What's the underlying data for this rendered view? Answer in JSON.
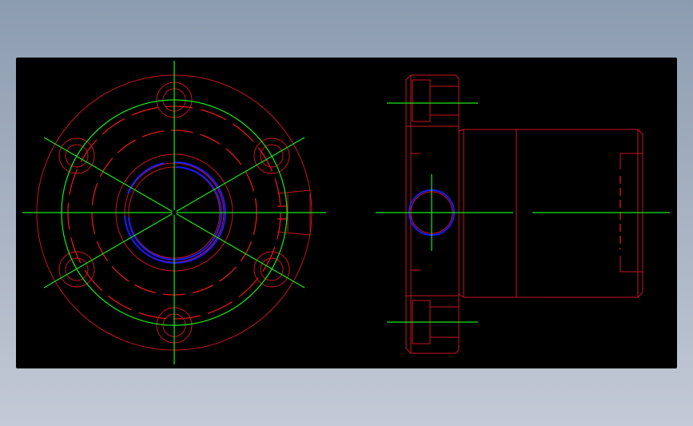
{
  "drawing": {
    "background": "#000000",
    "colors": {
      "outline": "#c8141e",
      "hidden": "#e01818",
      "centerline": "#18e818",
      "thread": "#1a1aff"
    },
    "bolt_holes": 6,
    "views": [
      "front-view",
      "side-view"
    ]
  }
}
